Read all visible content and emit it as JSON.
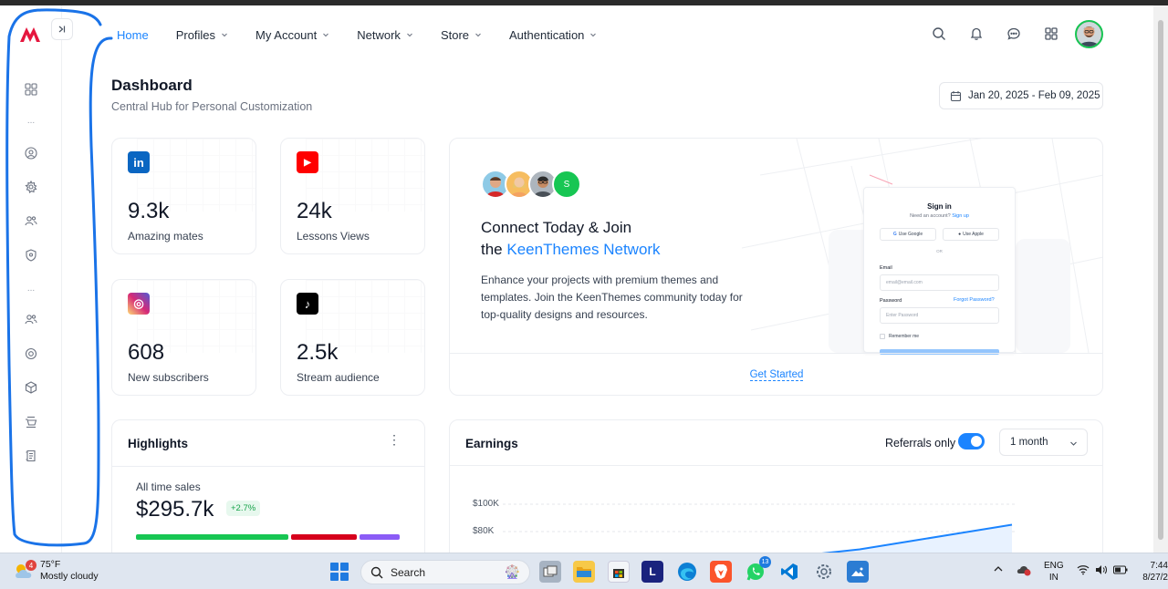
{
  "nav": {
    "items": [
      {
        "label": "Home",
        "active": true,
        "dropdown": false
      },
      {
        "label": "Profiles",
        "dropdown": true
      },
      {
        "label": "My Account",
        "dropdown": true
      },
      {
        "label": "Network",
        "dropdown": true
      },
      {
        "label": "Store",
        "dropdown": true
      },
      {
        "label": "Authentication",
        "dropdown": true
      }
    ]
  },
  "header_icons": [
    "search-icon",
    "bell-icon",
    "chat-icon",
    "apps-grid-icon"
  ],
  "sidebar": {
    "icons": [
      "dashboard-grid-icon",
      "user-circle-icon",
      "gear-icon",
      "users-icon",
      "shield-icon",
      "users-group-icon",
      "settings-circle-icon",
      "cube-icon",
      "cart-icon",
      "document-icon"
    ],
    "separator": "..."
  },
  "page": {
    "title": "Dashboard",
    "subtitle": "Central Hub for Personal Customization",
    "date_range": "Jan 20, 2025 - Feb 09, 2025"
  },
  "stats": [
    {
      "brand": "linkedin",
      "glyph": "in",
      "color": "#0a66c2",
      "value": "9.3k",
      "label": "Amazing mates"
    },
    {
      "brand": "youtube",
      "glyph": "▶",
      "color": "#ff0000",
      "value": "24k",
      "label": "Lessons Views"
    },
    {
      "brand": "instagram",
      "glyph": "◎",
      "color": "#d62976",
      "value": "608",
      "label": "New subscribers"
    },
    {
      "brand": "tiktok",
      "glyph": "♪",
      "color": "#000000",
      "value": "2.5k",
      "label": "Stream audience"
    }
  ],
  "connect": {
    "avatar_letter": "S",
    "title_line1": "Connect Today & Join",
    "title_prefix": "the",
    "title_accent": "KeenThemes Network",
    "description": "Enhance your projects with premium themes and templates. Join the KeenThemes community today for top-quality designs and resources.",
    "cta": "Get Started",
    "signin": {
      "title": "Sign in",
      "prompt": "Need an account?",
      "signup": "Sign up",
      "google": "Use Google",
      "apple": "Use Apple",
      "or": "OR",
      "email_label": "Email",
      "email_placeholder": "email@email.com",
      "password_label": "Password",
      "forgot": "Forgot Password?",
      "password_placeholder": "Enter Password",
      "remember": "Remember me"
    }
  },
  "highlights": {
    "title": "Highlights",
    "label": "All time sales",
    "amount": "$295.7k",
    "change": "+2.7%",
    "bars": [
      {
        "color": "#17c653",
        "share": 0.58
      },
      {
        "color": "#d6001c",
        "share": 0.25
      },
      {
        "color": "#8b5cf6",
        "share": 0.15
      }
    ]
  },
  "earnings": {
    "title": "Earnings",
    "referrals_label": "Referrals only",
    "referrals_on": true,
    "period": "1 month"
  },
  "chart_data": {
    "type": "area",
    "ylabels": [
      "$100K",
      "$80K"
    ],
    "series": [
      {
        "values": [
          60,
          60,
          60,
          60,
          60,
          61,
          63,
          67,
          73,
          79,
          85
        ]
      }
    ],
    "ylim": [
      60,
      100
    ]
  },
  "taskbar": {
    "weather_temp": "75°F",
    "weather_desc": "Mostly cloudy",
    "weather_badge": "4",
    "search": "Search",
    "whatsapp_badge": "13",
    "lang_top": "ENG",
    "lang_bottom": "IN",
    "time": "7:44",
    "date": "8/27/2"
  }
}
